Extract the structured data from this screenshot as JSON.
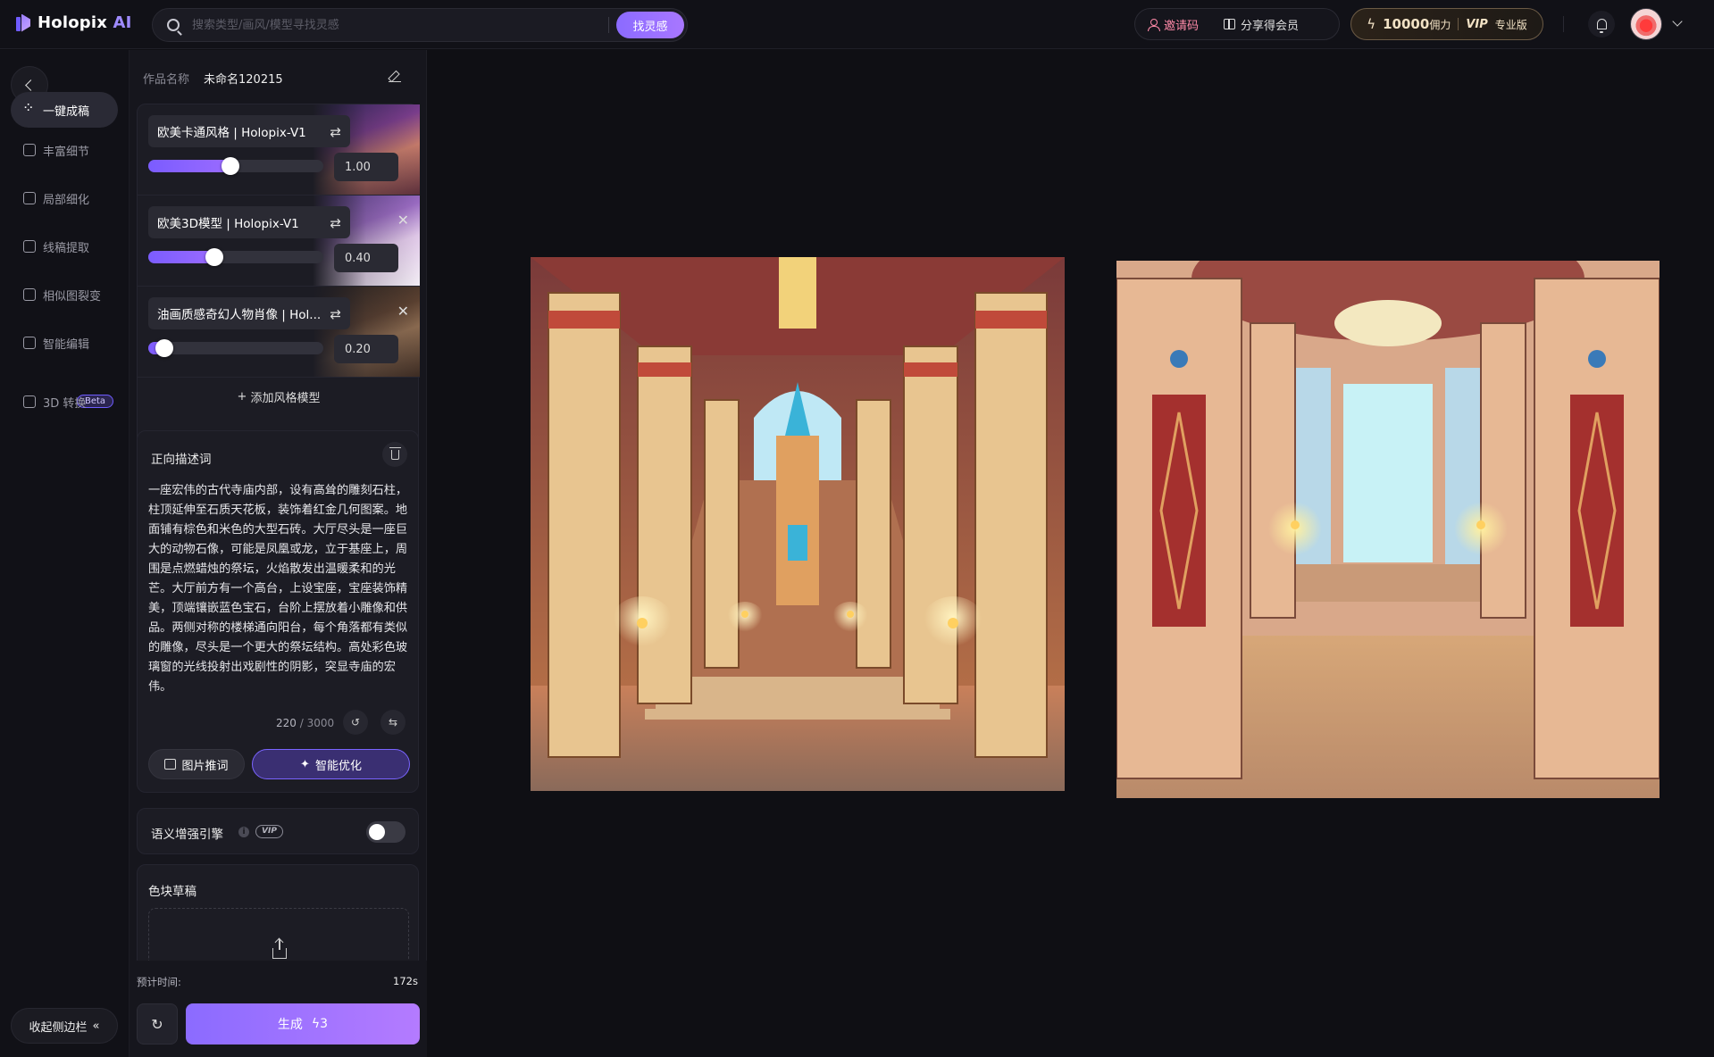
{
  "header": {
    "logo_text": "Holopix",
    "logo_ai": "AI",
    "search_placeholder": "搜索类型/画风/模型寻找灵感",
    "search_button": "找灵感",
    "invite_label": "邀请码",
    "share_label": "分享得会员",
    "points_value": "10000",
    "points_unit": "佣力",
    "vip_badge": "VIP",
    "vip_tier": "专业版"
  },
  "nav": {
    "items": [
      {
        "label": "一键成稿",
        "icon": "quick-draft-icon",
        "active": true
      },
      {
        "label": "丰富细节",
        "icon": "enrich-detail-icon"
      },
      {
        "label": "局部细化",
        "icon": "local-refine-icon"
      },
      {
        "label": "线稿提取",
        "icon": "lineart-extract-icon"
      },
      {
        "label": "相似图裂变",
        "icon": "similar-image-icon"
      },
      {
        "label": "智能编辑",
        "icon": "smart-edit-icon"
      },
      {
        "label": "3D 转换",
        "icon": "3d-convert-icon"
      }
    ],
    "beta_badge": "Beta",
    "collapse_label": "收起侧边栏"
  },
  "panel": {
    "work_name_label": "作品名称",
    "work_name_value": "未命名120215",
    "models": [
      {
        "name": "欧美卡通风格 | Holopix-V1",
        "weight": "1.00",
        "fraction": 0.55
      },
      {
        "name": "欧美3D模型 | Holopix-V1",
        "weight": "0.40",
        "fraction": 0.35
      },
      {
        "name": "油画质感奇幻人物肖像 | Hol...",
        "weight": "0.20",
        "fraction": 0.07
      }
    ],
    "add_model_label": "添加风格模型",
    "prompt_title": "正向描述词",
    "prompt_text": "一座宏伟的古代寺庙内部，设有高耸的雕刻石柱，柱顶延伸至石质天花板，装饰着红金几何图案。地面铺有棕色和米色的大型石砖。大厅尽头是一座巨大的动物石像，可能是凤凰或龙，立于基座上，周围是点燃蜡烛的祭坛，火焰散发出温暖柔和的光芒。大厅前方有一个高台，上设宝座，宝座装饰精美，顶端镶嵌蓝色宝石，台阶上摆放着小雕像和供品。两侧对称的楼梯通向阳台，每个角落都有类似的雕像，尽头是一个更大的祭坛结构。高处彩色玻璃窗的光线投射出戏剧性的阴影，突显寺庙的宏伟。",
    "prompt_count": "220",
    "prompt_max": "/ 3000",
    "img_prompt_label": "图片推词",
    "ai_optimize_label": "智能优化",
    "semantic_label": "语义增强引擎",
    "semantic_vip": "VIP",
    "sketch_label": "色块草稿",
    "est_label": "预计时间:",
    "est_value": "172s",
    "generate_label": "生成",
    "generate_cost": "3"
  }
}
